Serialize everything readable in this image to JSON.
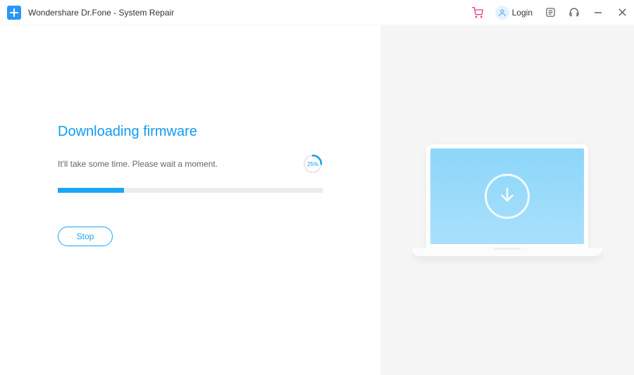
{
  "titlebar": {
    "app_title": "Wondershare Dr.Fone - System Repair",
    "login_label": "Login"
  },
  "main": {
    "heading": "Downloading firmware",
    "subtext": "It'll take some time. Please wait a moment.",
    "progress_percent": 25,
    "progress_percent_label": "25%",
    "stop_label": "Stop"
  },
  "colors": {
    "accent": "#129af2",
    "progress_fill": "#18a6f7",
    "screen_gradient_top": "#8cd6fa",
    "screen_gradient_bottom": "#a9e0fb",
    "right_bg": "#f5f5f5"
  }
}
